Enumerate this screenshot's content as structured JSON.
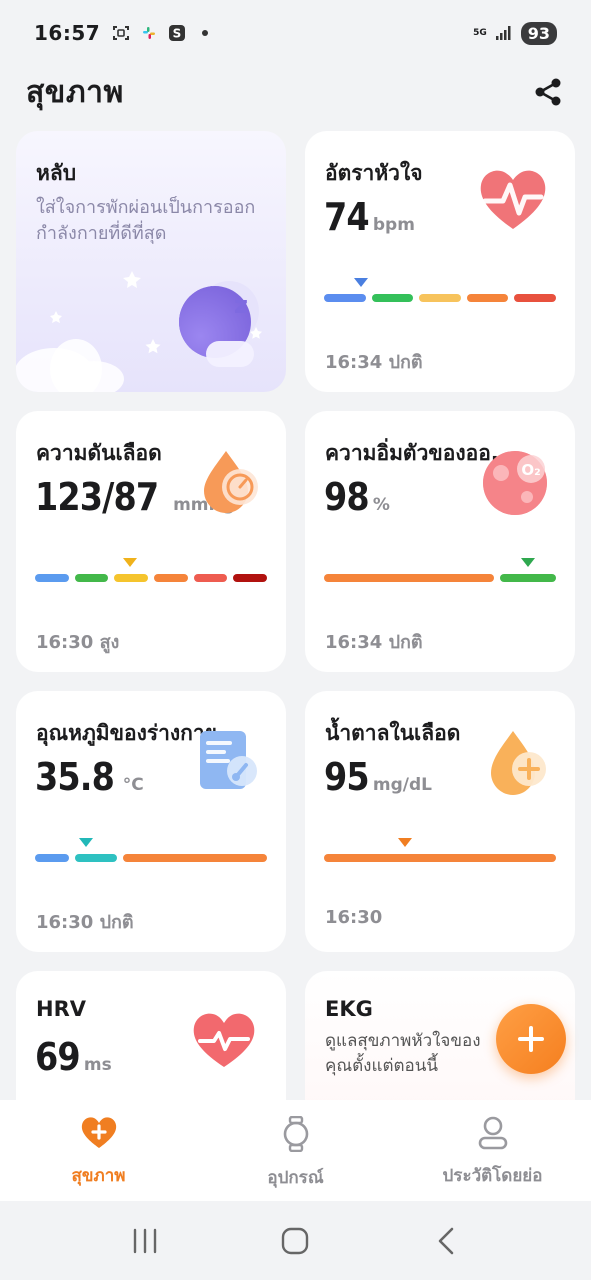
{
  "status_bar": {
    "time": "16:57",
    "network": "5G",
    "battery": "93"
  },
  "header": {
    "title": "สุขภาพ",
    "share_icon": "share-icon"
  },
  "cards": {
    "sleep": {
      "title": "หลับ",
      "subtitle": "ใส่ใจการพักผ่อนเป็นการออกกำลังกายที่ดีที่สุด",
      "icon": "moon-sleep-icon"
    },
    "heart_rate": {
      "title": "อัตราหัวใจ",
      "value": "74",
      "unit": "bpm",
      "status": "16:34 ปกติ",
      "icon": "heart-rate-icon",
      "segments": [
        "#5b8def",
        "#34c05a",
        "#f7c35c",
        "#f5843a",
        "#e8513e"
      ],
      "marker_color": "#4a7fe0",
      "marker_fraction": 0.16
    },
    "blood_pressure": {
      "title": "ความดันเลือด",
      "value": "123/87",
      "unit": "mmHg",
      "status": "16:30 สูง",
      "icon": "blood-pressure-icon",
      "segments": [
        "#5b9bef",
        "#43b84a",
        "#f5c42d",
        "#f5843a",
        "#ee5c50",
        "#b1120f"
      ],
      "marker_color": "#f0b21b",
      "marker_fraction": 0.41
    },
    "spo2": {
      "title": "ความอิ่มตัวของออ...",
      "value": "98",
      "unit": "%",
      "status": "16:34 ปกติ",
      "icon": "oxygen-icon",
      "segments": [
        "#f5843a",
        "#43b84a"
      ],
      "marker_color": "#2fa84f",
      "marker_fraction": 0.88
    },
    "temperature": {
      "title": "อุณหภูมิของร่างกาย",
      "value": "35.8",
      "unit": "°C",
      "status": "16:30 ปกติ",
      "icon": "thermometer-icon",
      "segments": [
        "#5b9bef",
        "#2ec1c1",
        "#f5843a"
      ],
      "marker_color": "#22b8b8",
      "marker_fraction": 0.22
    },
    "blood_sugar": {
      "title": "น้ำตาลในเลือด",
      "value": "95",
      "unit": "mg/dL",
      "status": "16:30",
      "icon": "blood-sugar-icon",
      "segments": [
        "#f5843a"
      ],
      "marker_color": "#f07e21",
      "marker_fraction": 0.35
    },
    "hrv": {
      "title": "HRV",
      "value": "69",
      "unit": "ms",
      "icon": "hrv-heart-icon"
    },
    "ekg": {
      "title": "EKG",
      "subtitle": "ดูแลสุขภาพหัวใจของคุณตั้งแต่ตอนนี้",
      "icon": "ekg-icon"
    }
  },
  "fab": {
    "icon": "plus-icon"
  },
  "bottom_nav": {
    "items": [
      {
        "label": "สุขภาพ",
        "icon": "health-heart-icon",
        "active": true
      },
      {
        "label": "อุปกรณ์",
        "icon": "watch-icon",
        "active": false
      },
      {
        "label": "ประวัติโดยย่อ",
        "icon": "profile-icon",
        "active": false
      }
    ]
  },
  "colors": {
    "accent": "#f07e21",
    "background": "#f2f3f5",
    "card": "#ffffff",
    "secondary_text": "#8e8e93"
  }
}
